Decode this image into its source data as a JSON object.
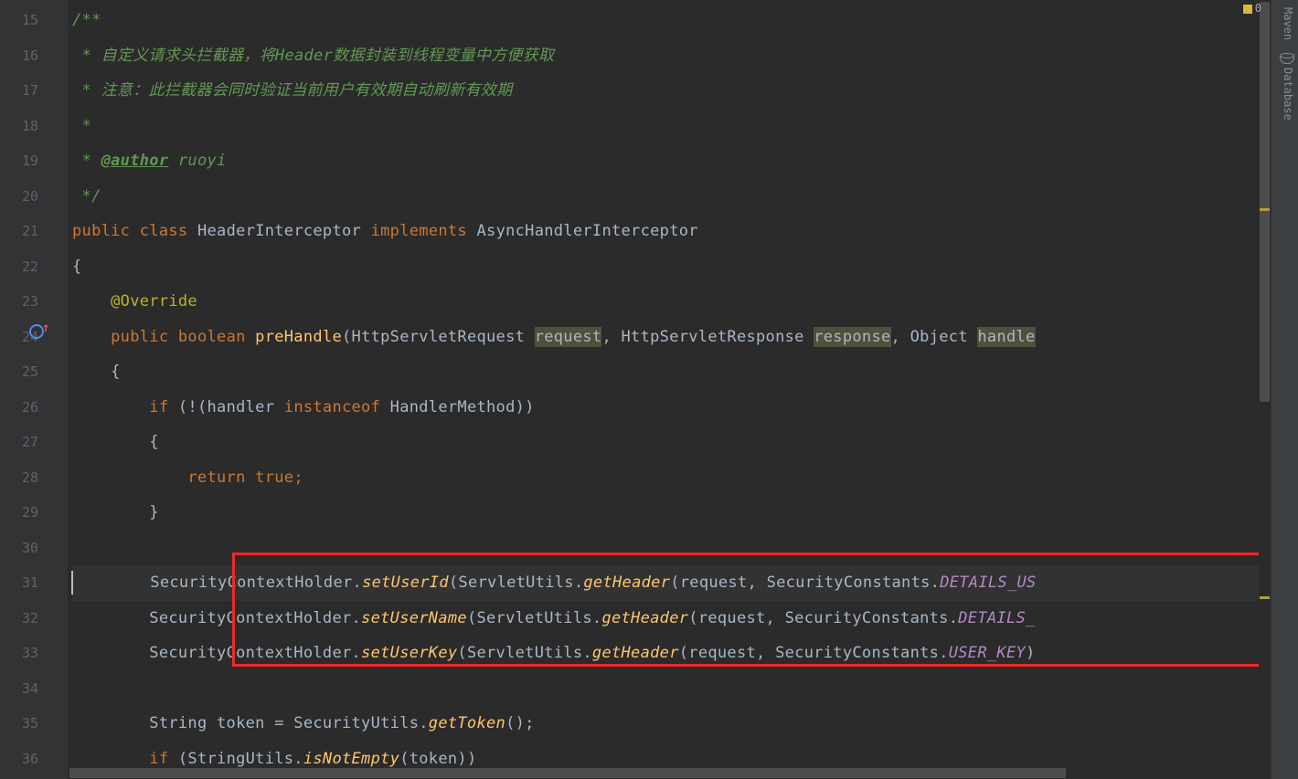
{
  "gutter": {
    "start": 15,
    "end": 36
  },
  "tools": {
    "maven": "Maven",
    "database": "Database"
  },
  "indicator": {
    "count": "0"
  },
  "code": {
    "l15": {
      "doc": "/**"
    },
    "l16": {
      "prefix": " * ",
      "text": "自定义请求头拦截器，将Header数据封装到线程变量中方便获取"
    },
    "l17": {
      "prefix": " * ",
      "text": "注意：此拦截器会同时验证当前用户有效期自动刷新有效期"
    },
    "l18": {
      "text": " *"
    },
    "l19": {
      "prefix": " * ",
      "tag": "@author",
      "rest": " ruoyi"
    },
    "l20": {
      "text": " */"
    },
    "l21": {
      "kw1": "public ",
      "kw2": "class ",
      "name": "HeaderInterceptor ",
      "kw3": "implements ",
      "iface": "AsyncHandlerInterceptor"
    },
    "l22": {
      "text": "{"
    },
    "l23": {
      "ann": "@Override"
    },
    "l24": {
      "kw1": "public ",
      "kw2": "boolean ",
      "m": "preHandle",
      "p1": "(HttpServletRequest ",
      "a1": "request",
      "c1": ", HttpServletResponse ",
      "a2": "response",
      "c2": ", Object ",
      "a3": "handle"
    },
    "l25": {
      "text": "{"
    },
    "l26": {
      "kw": "if ",
      "p1": "(!(handler ",
      "kw2": "instanceof ",
      "p2": "HandlerMethod))"
    },
    "l27": {
      "text": "{"
    },
    "l28": {
      "kw": "return ",
      "kw2": "true",
      "sc": ";"
    },
    "l29": {
      "text": "}"
    },
    "l31": {
      "cls": "SecurityContextHolder.",
      "m": "setUserId",
      "p1": "(ServletUtils.",
      "m2": "getHeader",
      "p2": "(request, SecurityConstants.",
      "c": "DETAILS_US"
    },
    "l32": {
      "cls": "SecurityContextHolder.",
      "m": "setUserName",
      "p1": "(ServletUtils.",
      "m2": "getHeader",
      "p2": "(request, SecurityConstants.",
      "c": "DETAILS_"
    },
    "l33": {
      "cls": "SecurityContextHolder.",
      "m": "setUserKey",
      "p1": "(ServletUtils.",
      "m2": "getHeader",
      "p2": "(request, SecurityConstants.",
      "c": "USER_KEY",
      "end": ")"
    },
    "l35": {
      "t1": "String token = SecurityUtils.",
      "m": "getToken",
      "t2": "();"
    },
    "l36": {
      "kw": "if ",
      "p1": "(StringUtils.",
      "m": "isNotEmpty",
      "p2": "(token))"
    }
  }
}
